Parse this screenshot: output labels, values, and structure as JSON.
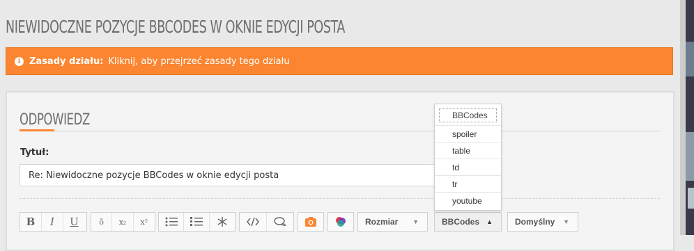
{
  "page_title": "NIEWIDOCZNE POZYCJE BBCODES W OKNIE EDYCJI POSTA",
  "notice": {
    "label": "Zasady działu:",
    "text": "Kliknij, aby przejrzeć zasady tego działu"
  },
  "reply": {
    "section_title": "ODPOWIEDZ",
    "subject_label": "Tytuł:",
    "subject_value": "Re: Niewidoczne pozycje BBCodes w oknie edycji posta"
  },
  "toolbar": {
    "bold": "B",
    "italic": "I",
    "underline": "U",
    "strike": "ō",
    "subscript": "x₂",
    "superscript": "x²",
    "size_select": "Rozmiar",
    "bbcodes_select": "BBCodes",
    "font_select": "Domyślny"
  },
  "bbcodes_dropdown": {
    "header": "BBCodes",
    "items": [
      "spoiler",
      "table",
      "td",
      "tr",
      "youtube"
    ]
  },
  "colors": {
    "accent": "#fb8530",
    "title_gray": "#6e6e6e"
  }
}
